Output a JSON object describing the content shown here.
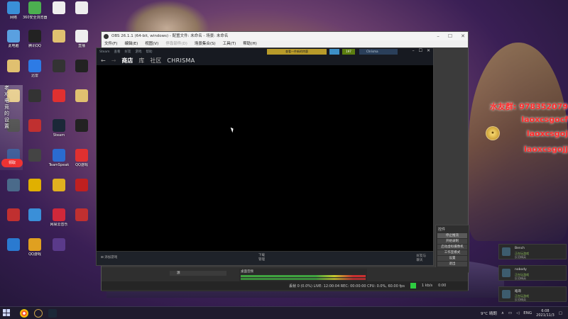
{
  "desktop_icons": [
    {
      "label": "网络",
      "color": "#3a8fd8"
    },
    {
      "label": "360安全浏览器",
      "color": "#4caf50"
    },
    {
      "label": "",
      "color": "#eee"
    },
    {
      "label": "",
      "color": "#eee"
    },
    {
      "label": "此电脑",
      "color": "#5aa0e0"
    },
    {
      "label": "腾讯QQ",
      "color": "#222"
    },
    {
      "label": "",
      "color": "#e0c070"
    },
    {
      "label": "直播",
      "color": "#eee"
    },
    {
      "label": "",
      "color": "#e0c070"
    },
    {
      "label": "迅雷",
      "color": "#2d7be5"
    },
    {
      "label": "",
      "color": "#333"
    },
    {
      "label": "",
      "color": "#222"
    },
    {
      "label": "",
      "color": "#e0c070"
    },
    {
      "label": "",
      "color": "#333"
    },
    {
      "label": "",
      "color": "#e03030"
    },
    {
      "label": "",
      "color": "#e0c070"
    },
    {
      "label": "",
      "color": "#333"
    },
    {
      "label": "",
      "color": "#c03030"
    },
    {
      "label": "Steam",
      "color": "#1b2838"
    },
    {
      "label": "",
      "color": "#222"
    },
    {
      "label": "",
      "color": "#2a4d8f"
    },
    {
      "label": "",
      "color": "#444"
    },
    {
      "label": "TeamSpeak",
      "color": "#2a6bd0"
    },
    {
      "label": "QQ游戏",
      "color": "#e03030"
    },
    {
      "label": "",
      "color": "#4a6a8a"
    },
    {
      "label": "",
      "color": "#e0b000"
    },
    {
      "label": "",
      "color": "#e0b020"
    },
    {
      "label": "",
      "color": "#c02020"
    },
    {
      "label": "",
      "color": "#c03030"
    },
    {
      "label": "",
      "color": "#3a8fd8"
    },
    {
      "label": "网易云音乐",
      "color": "#d0283a"
    },
    {
      "label": "",
      "color": "#c03030"
    },
    {
      "label": "",
      "color": "#2a7ad0"
    },
    {
      "label": "QQ游戏",
      "color": "#e0a020"
    },
    {
      "label": "",
      "color": "#5a3a8a"
    }
  ],
  "red_overlay": {
    "line1": "水友群: 978352079",
    "line2": "laoxcsgocf",
    "line3": "laoxcsgoj",
    "line4": "laoxcsgojj"
  },
  "obs": {
    "title": "OBS 26.1.1 (64-bit, windows) - 配置文件: 未命名 - 场景: 未命名",
    "menu": [
      "文件(F)",
      "编辑(E)",
      "视图(V)",
      "停靠部件(D)",
      "场景集合(S)",
      "工具(T)",
      "帮助(H)"
    ],
    "controls_header": "控件",
    "controls_buttons": [
      "停止推流",
      "开始录制",
      "启动虚拟摄像机",
      "工作室模式",
      "设置",
      "退出"
    ],
    "mixer_label": "桌面音频",
    "source_item": "源",
    "status_text": "丢帧 0 (0.0%)   LIVE: 12:00:04   REC: 00:00:00   CPU: 0.0%, 60.00 fps",
    "status_rate": "1 kb/s",
    "status_time": "0:00"
  },
  "steam": {
    "top_menu": [
      "Steam",
      "查看",
      "好友",
      "游戏",
      "帮助"
    ],
    "gold_button": "查看一件新的特惠",
    "badge": "197",
    "user": "Chrisma",
    "nav": {
      "store": "商店",
      "library": "库",
      "community": "社区",
      "username": "CHRISMA"
    },
    "add_game": "添加游戏",
    "downloads": "下载",
    "downloads_sub": "管理",
    "friends": "好友与\n聊天"
  },
  "notifications": [
    {
      "name": "Bench",
      "line1": "正在玩游戏",
      "line2": "反恐精英"
    },
    {
      "name": "nobody",
      "line1": "正在玩游戏",
      "line2": "反恐精英"
    },
    {
      "name": "皓哥",
      "line1": "正在玩游戏",
      "line2": "反恐精英"
    }
  ],
  "taskbar": {
    "weather": "9°C 晴朗",
    "lang": "ENG",
    "time": "6:08",
    "date": "2021/11/3"
  },
  "promo": {
    "lines": [
      "老",
      "X",
      "电",
      "竞",
      "的",
      "设",
      "置"
    ],
    "button": "领取"
  }
}
